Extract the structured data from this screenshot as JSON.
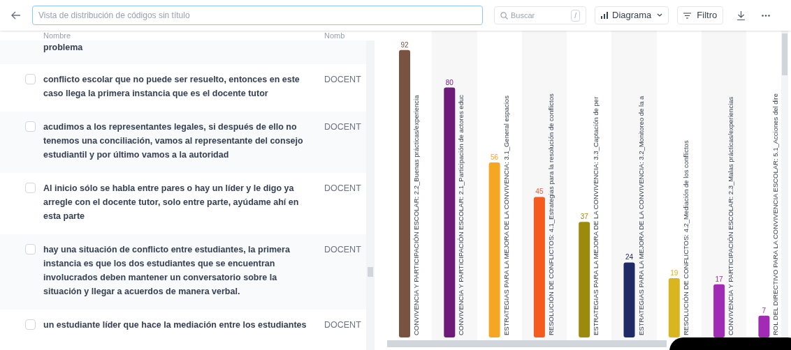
{
  "toolbar": {
    "title_placeholder": "Vista de distribución de códigos sin título",
    "search_placeholder": "Buscar",
    "search_shortcut": "/",
    "view_button": "Diagrama",
    "filter_button": "Filtro"
  },
  "table": {
    "columns": [
      "Nombre",
      "Nomb"
    ],
    "rows": [
      {
        "text": "problema",
        "column_2": ""
      },
      {
        "text": "conflicto escolar que no puede ser resuelto, entonces en este caso llega la primera instancia que es el docente tutor",
        "column_2": "DOCENT",
        "checked": false
      },
      {
        "text": "acudimos a los representantes legales, si después de ello no tenemos una conciliación, vamos al representante del consejo estudiantil y por último vamos a la autoridad",
        "column_2": "DOCENT",
        "checked": false
      },
      {
        "text": "Al inicio sólo se habla entre pares o hay un líder y le digo ya arregle con el docente tutor, solo entre parte, ayúdame ahí en esta parte",
        "column_2": "DOCENT",
        "checked": false
      },
      {
        "text": "hay una situación de conflicto entre estudiantes, la primera instancia es que los dos estudiantes que se encuentran involucrados deben mantener un conversatorio sobre la situación y llegar a acuerdos de manera verbal.",
        "column_2": "DOCENT",
        "checked": false
      },
      {
        "text": "un estudiante líder que hace la mediación entre los estudiantes",
        "column_2": "DOCENT",
        "checked": false
      }
    ]
  },
  "chart": {
    "chart_data": {
      "type": "bar",
      "orientation": "vertical",
      "data_labels": true,
      "categories": [
        "CONVIVENCIA Y PARTICIPACIÓN ESCOLAR: 2.2_Buenas prácticas/experiencia",
        "CONVIVENCIA Y PARTICIPACIÓN ESCOLAR: 2.1_Participación de actores educ",
        "ESTRATEGIAS PARA LA MEJORA DE LA CONVIVENCIA: 3.1_General espacios",
        "RESOLUCIÓN DE CONFLICTOS: 4.1_Estrategias para la resolución de conflictos",
        "ESTRATEGIAS PARA LA MEJORA DE LA CONVIVENCIA: 3.3_Captación de per",
        "ESTRATEGIAS PARA LA MEJORA DE LA CONVIVENCIA: 3.2_Monitoreo de la a",
        "RESOLUCIÓN DE CONFLICTOS: 4.2_Mediación de los conflictos",
        "CONVIVENCIA Y PARTICIPACIÓN ESCOLAR: 2.3_Malas prácticas/experiencias",
        "ROL DEL DIRECTIVO PARA LA CONVIVENCIA ESCOLAR: 5.1_Acciones del dire"
      ],
      "values": [
        92,
        80,
        56,
        45,
        37,
        24,
        19,
        17,
        7
      ],
      "colors": [
        "#7a5242",
        "#6e1a7a",
        "#f5a623",
        "#f55a1f",
        "#9c8a0c",
        "#1f2a66",
        "#d9b51f",
        "#a12bb5",
        "#a12bb5"
      ]
    }
  }
}
